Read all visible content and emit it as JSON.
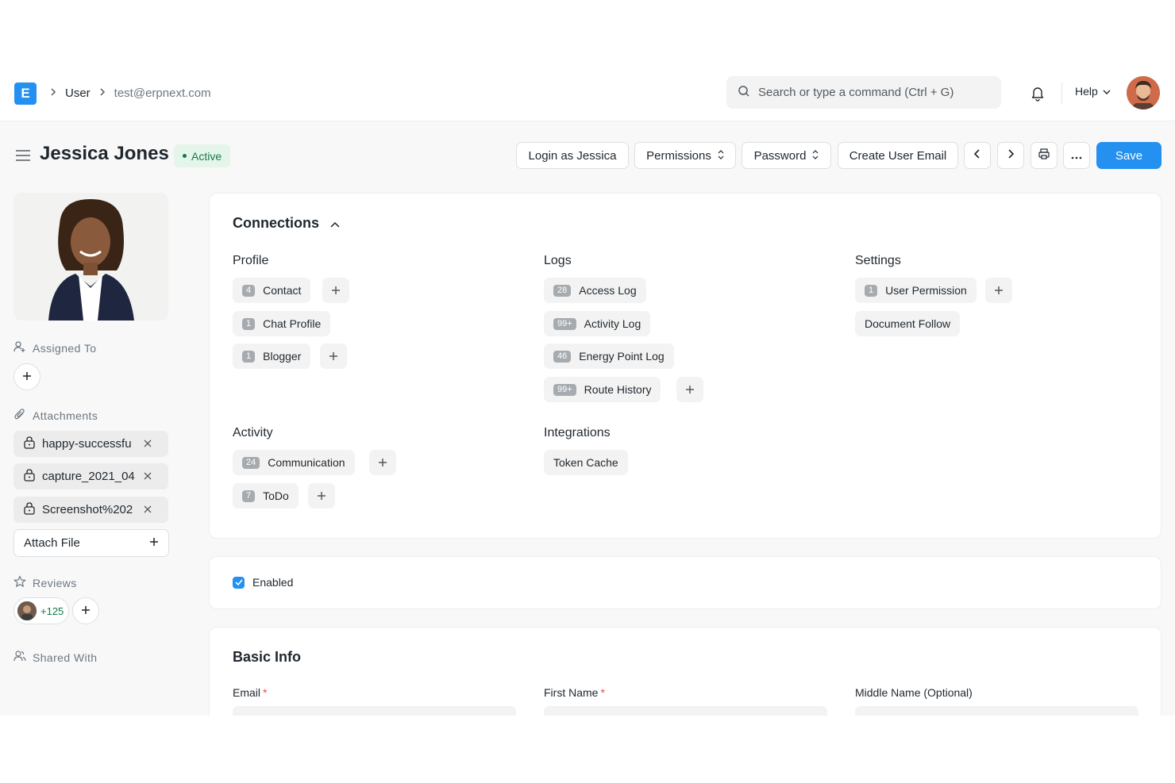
{
  "navbar": {
    "logo_letter": "E",
    "breadcrumbs": [
      "User",
      "test@erpnext.com"
    ],
    "search_placeholder": "Search or type a command (Ctrl + G)",
    "help_label": "Help"
  },
  "page": {
    "title": "Jessica Jones",
    "status": "Active",
    "status_color": "#16794c",
    "accent_color": "#2490ef"
  },
  "actions": {
    "login_as": "Login as Jessica",
    "permissions": "Permissions",
    "password": "Password",
    "create_user_email": "Create User Email",
    "save": "Save"
  },
  "sidebar": {
    "assigned_to": "Assigned To",
    "attachments_label": "Attachments",
    "attachments": [
      "happy-successfu",
      "capture_2021_04",
      "Screenshot%202"
    ],
    "attach_file": "Attach File",
    "reviews_label": "Reviews",
    "reviews_count": "+125",
    "shared_with": "Shared With"
  },
  "connections": {
    "title": "Connections",
    "groups": {
      "profile": {
        "title": "Profile",
        "items": [
          {
            "count": "4",
            "label": "Contact"
          },
          {
            "count": "1",
            "label": "Chat Profile"
          },
          {
            "count": "1",
            "label": "Blogger"
          }
        ]
      },
      "logs": {
        "title": "Logs",
        "items": [
          {
            "count": "28",
            "label": "Access Log"
          },
          {
            "count": "99+",
            "label": "Activity Log"
          },
          {
            "count": "46",
            "label": "Energy Point Log"
          },
          {
            "count": "99+",
            "label": "Route History"
          }
        ]
      },
      "settings": {
        "title": "Settings",
        "items": [
          {
            "count": "1",
            "label": "User Permission"
          },
          {
            "count": "",
            "label": "Document Follow"
          }
        ]
      },
      "activity": {
        "title": "Activity",
        "items": [
          {
            "count": "24",
            "label": "Communication"
          },
          {
            "count": "7",
            "label": "ToDo"
          }
        ]
      },
      "integrations": {
        "title": "Integrations",
        "items": [
          {
            "count": "",
            "label": "Token Cache"
          }
        ]
      }
    }
  },
  "enabled": {
    "label": "Enabled",
    "checked": true
  },
  "basic_info": {
    "title": "Basic Info",
    "fields": {
      "email": "Email",
      "first_name": "First Name",
      "middle_name": "Middle Name (Optional)"
    },
    "required_mark": "*"
  }
}
